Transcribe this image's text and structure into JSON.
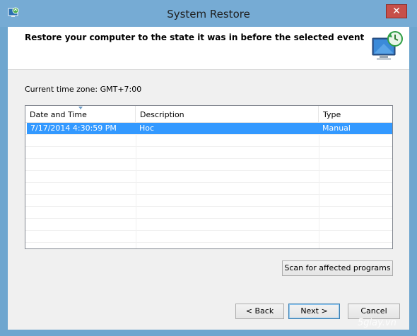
{
  "window": {
    "title": "System Restore",
    "close_glyph": "✕"
  },
  "header": {
    "heading": "Restore your computer to the state it was in before the selected event",
    "icon": "system-restore-icon"
  },
  "timezone": "Current time zone: GMT+7:00",
  "table": {
    "columns": [
      "Date and Time",
      "Description",
      "Type"
    ],
    "rows": [
      {
        "date": "7/17/2014 4:30:59 PM",
        "description": "Hoc",
        "type": "Manual",
        "selected": true
      }
    ]
  },
  "buttons": {
    "scan": "Scan for affected programs",
    "back": "< Back",
    "next": "Next >",
    "cancel": "Cancel"
  },
  "colors": {
    "selection": "#3399ff",
    "titlebar": "#76abd4",
    "close": "#c7504a"
  },
  "watermark": "5giay.vn"
}
